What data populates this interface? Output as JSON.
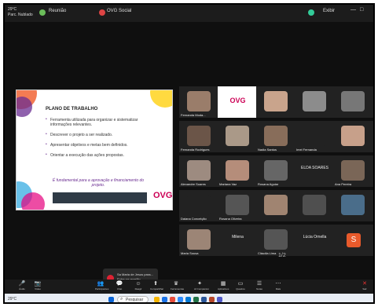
{
  "topbar": {
    "weather": "29°C",
    "weather_sub": "Parc. Nublado",
    "zoom_tab": "Reunião",
    "ovg_tab": "OVG Social",
    "right_status": "Exibir"
  },
  "slide": {
    "title": "PLANO DE TRABALHO",
    "bullets": [
      "Ferramenta utilizada para organizar e sistematizar informações relevantes.",
      "Descrever o projeto a ser realizado.",
      "Apresentar objetivos e metas bem definidos.",
      "Orientar a execução das ações propostas."
    ],
    "emphasis": "É fundamental para a aprovação e financiamento do projeto.",
    "logo": "OVG"
  },
  "participants": [
    {
      "name": "Fernanda Moda...",
      "kind": "video",
      "color": "#9a7d6a"
    },
    {
      "name": "OVG",
      "kind": "logo",
      "color": "#ffffff"
    },
    {
      "name": "",
      "kind": "video",
      "color": "#c9a48c"
    },
    {
      "name": "",
      "kind": "video",
      "color": "#8c8c8c"
    },
    {
      "name": "",
      "kind": "video",
      "color": "#777"
    },
    {
      "name": "Fernanda Rodrigues",
      "kind": "video",
      "color": "#6b5548"
    },
    {
      "name": "",
      "kind": "video",
      "color": "#aa9988"
    },
    {
      "name": "Nadia Santos",
      "kind": "video",
      "color": "#886d5a"
    },
    {
      "name": "Imei Fernanda",
      "kind": "video",
      "color": "#222"
    },
    {
      "name": "",
      "kind": "video",
      "color": "#c7a08a"
    },
    {
      "name": "Alexandre Soares",
      "kind": "video",
      "color": "#9d8b80"
    },
    {
      "name": "Mariana Vaz",
      "kind": "video",
      "color": "#b58d7a"
    },
    {
      "name": "Rosana Aguiar",
      "kind": "video",
      "color": "#666"
    },
    {
      "name": "ELDA SOARES",
      "kind": "name",
      "color": "#222"
    },
    {
      "name": "Ana Pereira",
      "kind": "video",
      "color": "#7a6657"
    },
    {
      "name": "Daiana Conceição",
      "kind": "video",
      "color": "#222"
    },
    {
      "name": "Rosana Oliveira",
      "kind": "video",
      "color": "#555"
    },
    {
      "name": "",
      "kind": "video",
      "color": "#a08471"
    },
    {
      "name": "",
      "kind": "video",
      "color": "#4f4f4f"
    },
    {
      "name": "",
      "kind": "video",
      "color": "#4a6d8a"
    },
    {
      "name": "Maria Sousa",
      "kind": "video",
      "color": "#9c8576"
    },
    {
      "name": "Milena",
      "kind": "name",
      "color": "#222"
    },
    {
      "name": "Cláudia Lima",
      "kind": "video",
      "color": "#555"
    },
    {
      "name": "Lúcia Ornella",
      "kind": "name",
      "color": "#222"
    },
    {
      "name": "S",
      "kind": "avatar",
      "color": "#e85a2b"
    }
  ],
  "pager": "1/2",
  "notification": {
    "line1": "Sa Maria de Jesus pass...",
    "line2": "Entre na reunião"
  },
  "controls": [
    {
      "icon": "mic-icon",
      "glyph": "🎤",
      "label": "Áudio"
    },
    {
      "icon": "video-icon",
      "glyph": "📷",
      "label": "Vídeo"
    },
    {
      "icon": "participants-icon",
      "glyph": "👥",
      "label": "Participantes"
    },
    {
      "icon": "chat-icon",
      "glyph": "💬",
      "label": "Chat"
    },
    {
      "icon": "react-icon",
      "glyph": "☺",
      "label": "Reagir"
    },
    {
      "icon": "share-icon",
      "glyph": "⬆",
      "label": "Compartilhar"
    },
    {
      "icon": "host-icon",
      "glyph": "♛",
      "label": "Ferramentas"
    },
    {
      "icon": "ai-icon",
      "glyph": "✦",
      "label": "AI Companion"
    },
    {
      "icon": "apps-icon",
      "glyph": "▦",
      "label": "Aplicativos"
    },
    {
      "icon": "whiteboard-icon",
      "glyph": "▭",
      "label": "Quadros"
    },
    {
      "icon": "notes-icon",
      "glyph": "☰",
      "label": "Notas"
    },
    {
      "icon": "more-icon",
      "glyph": "⋯",
      "label": "Mais"
    },
    {
      "icon": "leave-icon",
      "glyph": "✕",
      "label": "Sair"
    }
  ],
  "taskbar": {
    "search_label": "Pesquisar",
    "weather": "29°C"
  }
}
